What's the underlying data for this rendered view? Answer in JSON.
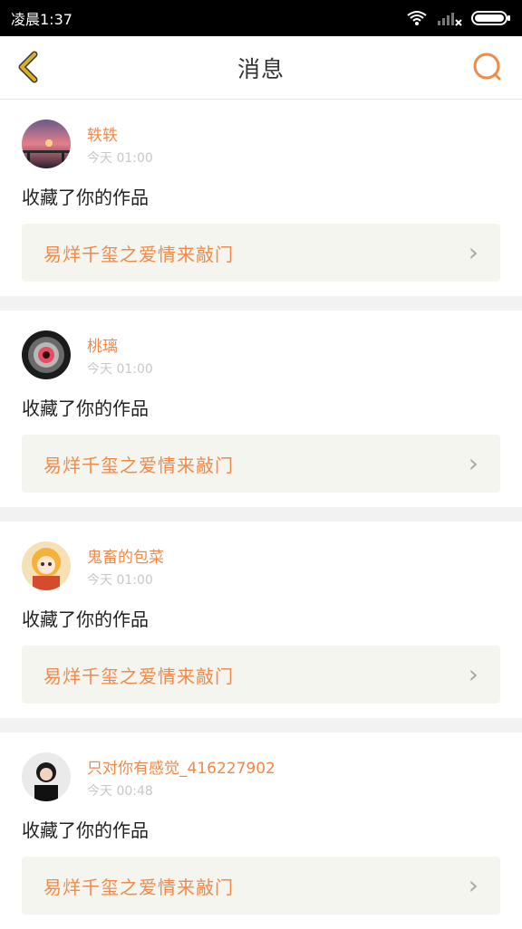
{
  "status_bar": {
    "carrier_time": "凌晨1:37",
    "icons": [
      "wifi-icon",
      "signal-icon",
      "battery-icon"
    ]
  },
  "header": {
    "title": "消息",
    "back_icon": "back-chevron-icon",
    "search_icon": "search-icon"
  },
  "messages": [
    {
      "user_name": "轶轶",
      "time_text": "今天 01:00",
      "action_text": "收藏了你的作品",
      "work_title": "易烊千玺之爱情来敲门",
      "avatar_icon": "sunset-avatar"
    },
    {
      "user_name": "桃璃",
      "time_text": "今天 01:00",
      "action_text": "收藏了你的作品",
      "work_title": "易烊千玺之爱情来敲门",
      "avatar_icon": "eye-avatar"
    },
    {
      "user_name": "鬼畜的包菜",
      "time_text": "今天 01:00",
      "action_text": "收藏了你的作品",
      "work_title": "易烊千玺之爱情来敲门",
      "avatar_icon": "anime-girl-avatar"
    },
    {
      "user_name": "只对你有感觉_416227902",
      "time_text": "今天 00:48",
      "action_text": "收藏了你的作品",
      "work_title": "易烊千玺之爱情来敲门",
      "avatar_icon": "person-avatar"
    }
  ],
  "colors": {
    "accent": "#f08a4a",
    "back_icon": "#d9b02a",
    "search_icon": "#f08a4a"
  }
}
